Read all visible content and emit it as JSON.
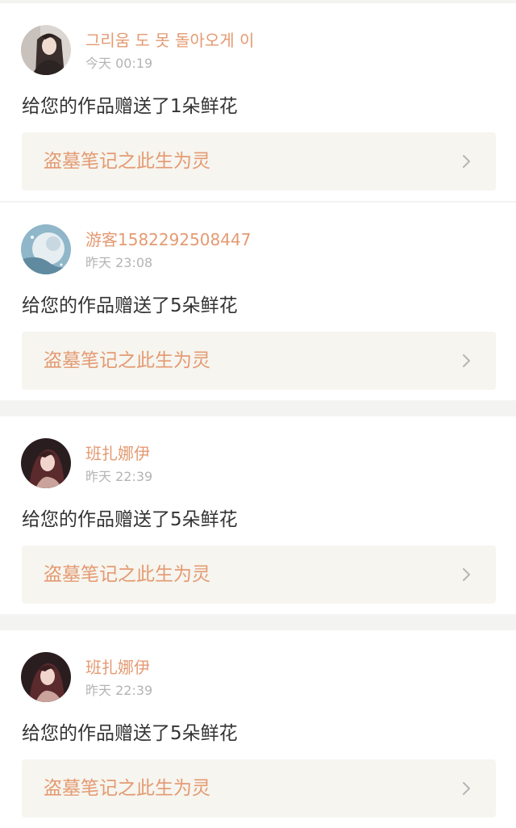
{
  "notifications": [
    {
      "user_name": "그리움 도 못 돌아오게 이",
      "time": "今天 00:19",
      "message": "给您的作品赠送了1朵鲜花",
      "work_title": "盗墓笔记之此生为灵",
      "avatar": "avatar-girl-profile"
    },
    {
      "user_name": "游客1582292508447",
      "time": "昨天 23:08",
      "message": "给您的作品赠送了5朵鲜花",
      "work_title": "盗墓笔记之此生为灵",
      "avatar": "avatar-blue-moon"
    },
    {
      "user_name": "班扎娜伊",
      "time": "昨天 22:39",
      "message": "给您的作品赠送了5朵鲜花",
      "work_title": "盗墓笔记之此生为灵",
      "avatar": "avatar-girl-dark"
    },
    {
      "user_name": "班扎娜伊",
      "time": "昨天 22:39",
      "message": "给您的作品赠送了5朵鲜花",
      "work_title": "盗墓笔记之此生为灵",
      "avatar": "avatar-girl-dark"
    }
  ],
  "colors": {
    "accent": "#e49a72",
    "timestamp": "#b4b4b4",
    "link_bg": "#f6f5ef",
    "separator": "#f3f3f1"
  },
  "icons": {
    "chevron": "chevron-right-icon"
  }
}
